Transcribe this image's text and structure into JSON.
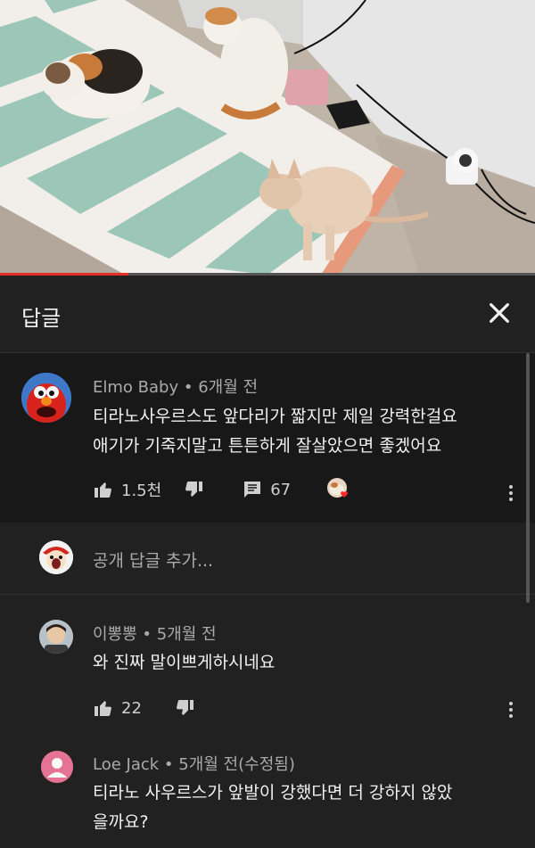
{
  "video": {
    "progress_percent": 24
  },
  "panel": {
    "title": "답글"
  },
  "main_comment": {
    "author": "Elmo Baby",
    "time": "6개월 전",
    "text_line1": "티라노사우르스도 앞다리가 짧지만 제일 강력한걸요",
    "text_line2": "애기가 기죽지말고 튼튼하게 잘살았으면 좋겠어요",
    "likes": "1.5천",
    "replies": "67"
  },
  "reply_input": {
    "placeholder": "공개 답글 추가..."
  },
  "replies": [
    {
      "author": "이뽕뽕",
      "time": "5개월 전",
      "text_line1": "와 진짜 말이쁘게하시네요",
      "likes": "22"
    },
    {
      "author": "Loe Jack",
      "time": "5개월 전(수정됨)",
      "text_line1": "티라노 사우르스가 앞발이 강했다면 더 강하지 않았",
      "text_line2": "을까요?"
    }
  ],
  "colors": {
    "accent": "#e52d27",
    "background": "#181818",
    "panel": "#212121",
    "avatar_pink": "#e57395"
  },
  "icons": [
    "close-icon",
    "thumbs-up-icon",
    "thumbs-down-icon",
    "comment-icon",
    "heart-icon",
    "more-vert-icon"
  ]
}
